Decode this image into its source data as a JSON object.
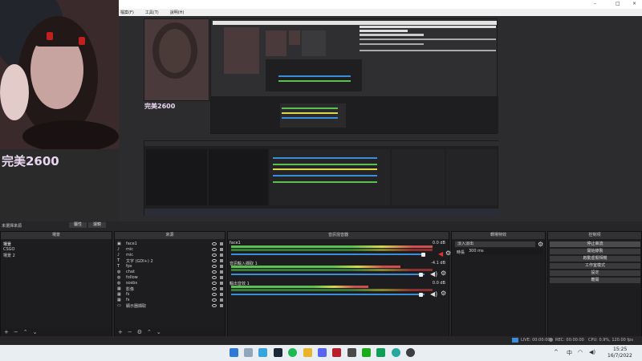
{
  "menu": {
    "items": [
      "檔案(F)",
      "工具(T)",
      "說明(H)"
    ]
  },
  "window_controls": {
    "minimize": "–",
    "maximize": "□",
    "close": "×"
  },
  "camera": {
    "caption": "完美2600"
  },
  "preview": {
    "caption": "完美2600"
  },
  "scene_toolbar": {
    "label": "未選擇來源",
    "properties": "屬性",
    "filters": "濾鏡"
  },
  "scenes": {
    "header": "場景",
    "items": [
      "場景",
      "CSGO",
      "場景 2"
    ]
  },
  "sources": {
    "header": "來源",
    "items": [
      {
        "label": "face1",
        "icon": "camera-icon"
      },
      {
        "label": "mic",
        "icon": "mic-icon"
      },
      {
        "label": "mic",
        "icon": "mic-icon"
      },
      {
        "label": "文字 (GDI+) 2",
        "icon": "text-icon"
      },
      {
        "label": "fps",
        "icon": "text-icon"
      },
      {
        "label": "chat",
        "icon": "browser-icon"
      },
      {
        "label": "follow",
        "icon": "browser-icon"
      },
      {
        "label": "sosbs",
        "icon": "browser-icon"
      },
      {
        "label": "影像",
        "icon": "image-icon"
      },
      {
        "label": "fs",
        "icon": "image-icon"
      },
      {
        "label": "fs",
        "icon": "image-icon"
      },
      {
        "label": "顯示器擷取",
        "icon": "monitor-icon"
      }
    ]
  },
  "mixer": {
    "header": "音訊混音器",
    "channels": [
      {
        "name": "face1",
        "db": "0.0 dB"
      },
      {
        "name": "音訊輸入擷取 1",
        "db": "-4.1 dB"
      },
      {
        "name": "輸出音效 1",
        "db": "0.0 dB"
      }
    ]
  },
  "transitions": {
    "header": "轉場特效",
    "selected": "淡入淡出",
    "duration_label": "時長",
    "duration_value": "300 ms"
  },
  "controls": {
    "header": "控制項",
    "buttons": [
      "停止串流",
      "開始錄製",
      "啟動虛擬相機",
      "工作室模式",
      "設定",
      "離開"
    ]
  },
  "status": {
    "live": "LIVE: 00:00:00",
    "rec": "REC: 00:00:00",
    "cpu": "CPU: 0.9%, 120.00 fps"
  },
  "taskbar": {
    "time": "15:25",
    "date": "16/7/2022",
    "lang": "中"
  },
  "colors": {
    "accent": "#3a8dd8",
    "caption": "#e8d6ef",
    "meter_green": "#5ac04e",
    "meter_yellow": "#d8d84a",
    "meter_red": "#d05050"
  }
}
